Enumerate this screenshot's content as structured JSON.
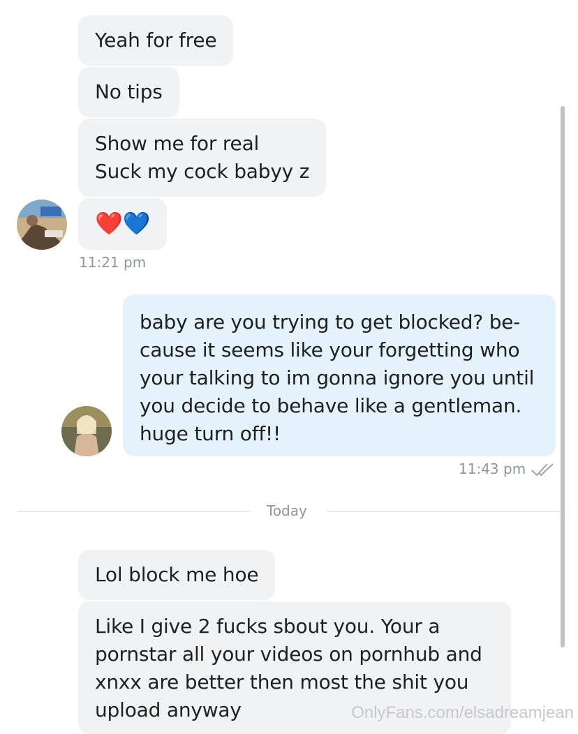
{
  "messages_before": [
    {
      "text": "Yeah for free"
    },
    {
      "text": "No tips"
    },
    {
      "text": "Show me for real\nSuck my cock babyy z"
    },
    {
      "text": "❤️💙"
    }
  ],
  "incoming_time_1": "11:21 pm",
  "outgoing_message": {
    "text": "baby are you trying to get blocked? be-\ncause it seems like your forgetting who\nyour talking to im gonna ignore you until\nyou decide to behave like a gentleman.\nhuge turn off!!",
    "time": "11:43 pm",
    "status_icon": "double-check-icon"
  },
  "divider": {
    "label": "Today"
  },
  "messages_today": [
    {
      "text": "Lol block me hoe"
    },
    {
      "text": "Like I give 2 fucks sbout you. Your a\npornstar all your videos on pornhub and\nxnxx are better then most the shit you\nupload anyway"
    }
  ],
  "watermark": "OnlyFans.com/elsadreamjean",
  "colors": {
    "incoming_bubble": "#f1f2f4",
    "outgoing_bubble": "#e3f2fb",
    "timestamp": "#8a96a3"
  }
}
